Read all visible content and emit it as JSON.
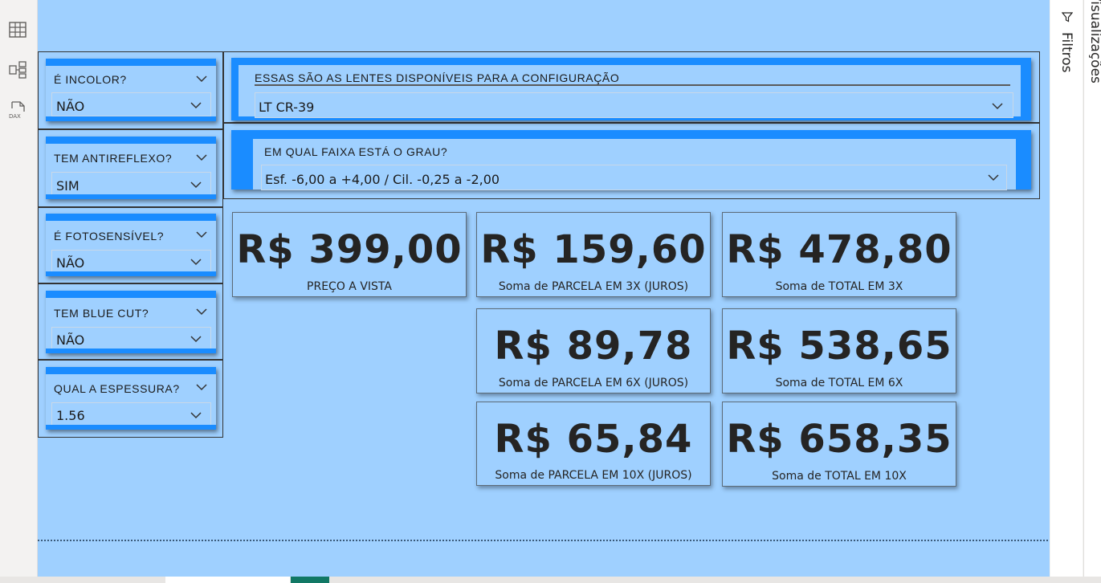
{
  "panes": {
    "filters_label": "Filtros",
    "visualizations_label": "Visualizações"
  },
  "rail": {
    "icons": [
      "table-icon",
      "model-icon",
      "dax-icon"
    ]
  },
  "slicers": [
    {
      "title": "É INCOLOR?",
      "value": "NÃO"
    },
    {
      "title": "TEM ANTIREFLEXO?",
      "value": "SIM"
    },
    {
      "title": "É FOTOSENSÍVEL?",
      "value": "NÃO"
    },
    {
      "title": "TEM BLUE CUT?",
      "value": "NÃO"
    },
    {
      "title": "QUAL A ESPESSURA?",
      "value": "1.56"
    }
  ],
  "lens_slicer": {
    "title": "ESSAS SÃO AS LENTES DISPONÍVEIS PARA A CONFIGURAÇÃO",
    "value": "LT CR-39"
  },
  "grade_slicer": {
    "title": "EM QUAL FAIXA ESTÁ O GRAU?",
    "value": "Esf. -6,00 a +4,00 / Cil. -0,25 a -2,00"
  },
  "cards": [
    {
      "value": "R$ 399,00",
      "label": "PREÇO A VISTA"
    },
    {
      "value": "R$ 159,60",
      "label": "Soma de PARCELA EM 3X (JUROS)"
    },
    {
      "value": "R$ 478,80",
      "label": "Soma de TOTAL EM 3X"
    },
    {
      "value": "R$ 89,78",
      "label": "Soma de PARCELA EM 6X (JUROS)"
    },
    {
      "value": "R$ 538,65",
      "label": "Soma de TOTAL EM 6X"
    },
    {
      "value": "R$ 65,84",
      "label": "Soma de PARCELA EM 10X (JUROS)"
    },
    {
      "value": "R$ 658,35",
      "label": "Soma de TOTAL EM 10X"
    }
  ],
  "colors": {
    "canvas": "#9fd0ff",
    "accent": "#1a8cff"
  }
}
